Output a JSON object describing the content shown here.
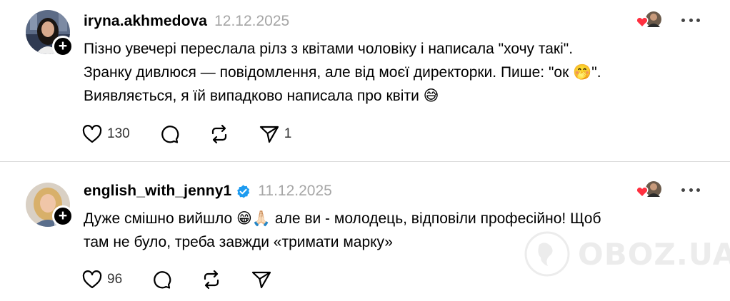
{
  "comments": [
    {
      "username": "iryna.akhmedova",
      "date": "12.12.2025",
      "verified": false,
      "text_lines": [
        "Пізно увечері переслала рілз з квітами чоловіку і написала \"хочу такі\".",
        "Зранку дивлюся — повідомлення, але від моєї директорки. Пише: \"ок 🤭\".",
        "Виявляється, я їй випадково написала про квіти 😅"
      ],
      "likes": "130",
      "reposts": "",
      "shares": "1"
    },
    {
      "username": "english_with_jenny1",
      "date": "11.12.2025",
      "verified": true,
      "text_lines": [
        "Дуже смішно вийшло 😁🙏🏻 але ви - молодець, відповіли професійно! Щоб",
        "там не було, треба завжди «тримати марку»"
      ],
      "likes": "96",
      "reposts": "",
      "shares": ""
    }
  ],
  "icons": {
    "like": "heart-icon",
    "comment": "comment-icon",
    "repost": "repost-icon",
    "share": "send-icon",
    "more": "more-icon",
    "follow": "plus-icon",
    "verified": "verified-badge-icon"
  },
  "colors": {
    "text": "#000000",
    "meta": "#a6a6a6",
    "verified": "#1d9bf0",
    "heart": "#ff3040",
    "divider": "#dbdbdb"
  },
  "watermark": {
    "text": "OBOZ.UA"
  }
}
